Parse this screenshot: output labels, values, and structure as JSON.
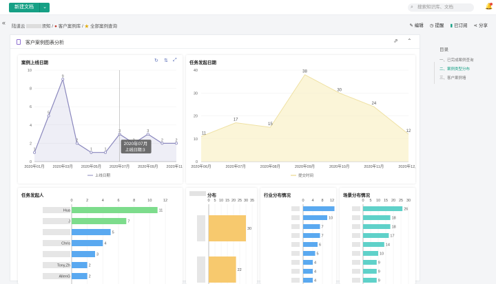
{
  "topbar": {
    "new_doc": "新建文档",
    "new_doc_arrow": "⌄",
    "search_placeholder": "搜索知识库、文档",
    "search_icon": "search-icon",
    "bell_icon": "bell-icon"
  },
  "breadcrumb": {
    "prefix": "陆道云",
    "item1_suffix": "须知 /",
    "item2": "客户案例库 /",
    "item3": "全部案例查询"
  },
  "actions": {
    "edit": "编辑",
    "remind": "提醒",
    "subscribed": "已订阅",
    "share": "分享"
  },
  "section": {
    "title": "客户案例图表分析"
  },
  "toc": {
    "heading": "目录",
    "items": [
      "一、已完成案例查询",
      "二、案例类型分布",
      "三、客户案例墙"
    ]
  },
  "chart_data": [
    {
      "type": "line",
      "title": "案例上线日期",
      "categories": [
        "2020年01月",
        "2020年02月",
        "2020年03月",
        "2020年04月",
        "2020年05月",
        "2020年06月",
        "2020年07月",
        "2020年08月",
        "2020年09月",
        "2020年10月",
        "2020年11月"
      ],
      "x_tick_labels": [
        "2020年01月",
        "2020年03月",
        "2020年05月",
        "2020年07月",
        "2020年09月",
        "2020年11月"
      ],
      "series": [
        {
          "name": "上线日期",
          "values": [
            1,
            5,
            9,
            2,
            1,
            1,
            3,
            2,
            3,
            2,
            2
          ]
        }
      ],
      "ylim": [
        0,
        10
      ],
      "y_ticks": [
        0,
        2,
        4,
        6,
        8,
        10
      ],
      "tooltip": {
        "title": "2020年07月",
        "label": "上线日期",
        "value": 3
      },
      "toolbar_icons": [
        "refresh-icon",
        "sort-icon",
        "expand-icon"
      ]
    },
    {
      "type": "area",
      "title": "任务发起日期",
      "categories": [
        "2020年06月",
        "2020年07月",
        "2020年08月",
        "2020年09月",
        "2020年10月",
        "2020年11月",
        "2020年12月"
      ],
      "series": [
        {
          "name": "提交时间",
          "values": [
            11,
            17,
            15,
            38,
            30,
            24,
            12
          ]
        }
      ],
      "ylim": [
        0,
        40
      ],
      "y_ticks": [
        0,
        10,
        20,
        30,
        40
      ]
    },
    {
      "type": "bar",
      "title": "任务发起人",
      "orientation": "horizontal",
      "x_ticks": [
        0,
        2,
        4,
        6,
        8,
        10,
        12
      ],
      "values": [
        11,
        7,
        5,
        4,
        3,
        2,
        2
      ],
      "labels_visible": [
        "Hua",
        "J",
        "",
        "Chris",
        "",
        "Tony,Zh",
        "AllenG"
      ],
      "colors": [
        "#7ddc8c",
        "#7ddc8c",
        "#5aa9f0",
        "#5aa9f0",
        "#5aa9f0",
        "#5aa9f0",
        "#5aa9f0"
      ]
    },
    {
      "type": "bar",
      "title": "分布",
      "orientation": "horizontal",
      "x_ticks": [
        0,
        5,
        10,
        15,
        20,
        25,
        30,
        35
      ],
      "values": [
        30,
        22
      ],
      "colors": [
        "#f7c96e",
        "#f7c96e"
      ]
    },
    {
      "type": "bar",
      "title": "行业分布情况",
      "orientation": "horizontal",
      "x_ticks": [
        0,
        4,
        8,
        12
      ],
      "values": [
        13,
        10,
        7,
        7,
        6,
        5,
        4,
        4,
        4
      ],
      "color": "#5aa9f0"
    },
    {
      "type": "bar",
      "title": "场景分布情况",
      "orientation": "horizontal",
      "x_ticks": [
        0,
        5,
        10,
        15,
        20,
        25,
        30
      ],
      "values": [
        26,
        18,
        18,
        17,
        14,
        10,
        9,
        9,
        9
      ],
      "color": "#5fd1c9"
    }
  ]
}
